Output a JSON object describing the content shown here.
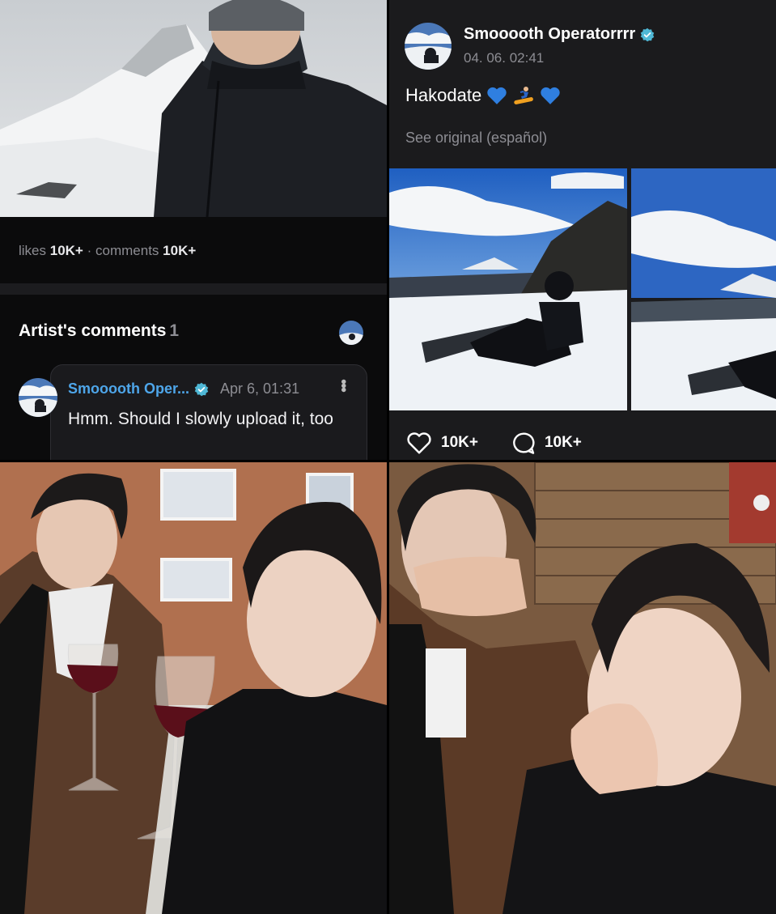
{
  "top_left": {
    "stats": {
      "likes_label": "likes",
      "likes_value": "10K+",
      "separator": "·",
      "comments_label": "comments",
      "comments_value": "10K+"
    },
    "artist_comments": {
      "title": "Artist's comments",
      "count": "1",
      "comment": {
        "author": "Smooooth Oper...",
        "time": "Apr 6, 01:31",
        "text": "Hmm. Should I slowly upload it, too"
      }
    }
  },
  "top_right": {
    "post": {
      "author": "Smooooth Operatorrrr",
      "timestamp": "04. 06. 02:41",
      "caption": "Hakodate",
      "caption_emoji": [
        "blue-heart-icon",
        "snowboarder-icon",
        "blue-heart-icon"
      ],
      "see_original": "See original (español)",
      "likes": "10K+",
      "comments": "10K+"
    }
  },
  "colors": {
    "verified_badge": "#4fb8d6",
    "name_link": "#4ea6ea",
    "muted_text": "#8d8d93",
    "blue_heart": "#2f7fe0"
  }
}
